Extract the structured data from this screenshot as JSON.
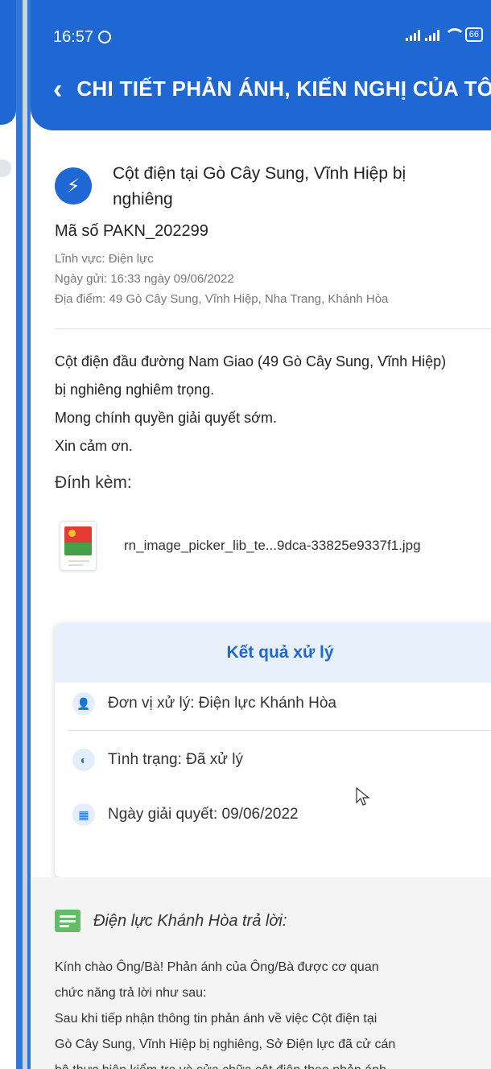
{
  "status_bar": {
    "time": "16:57",
    "battery": "66"
  },
  "header": {
    "title": "CHI TIẾT PHẢN ÁNH, KIẾN NGHỊ CỦA TÔI"
  },
  "issue": {
    "title": "Cột điện tại Gò Cây Sung, Vĩnh Hiệp bị nghiêng",
    "code": "Mã số PAKN_202299",
    "field": "Lĩnh vực: Điện lực",
    "sent_date": "Ngày gửi: 16:33 ngày 09/06/2022",
    "location": "Địa điểm: 49 Gò Cây Sung, Vĩnh Hiệp, Nha Trang, Khánh Hòa",
    "description": [
      "Cột điện đầu đường Nam Giao (49 Gò Cây Sung, Vĩnh Hiệp)",
      "bị nghiêng nghiêm trọng.",
      "Mong chính quyền giải quyết sớm.",
      "Xin cảm ơn."
    ],
    "attachment_label": "Đính kèm:",
    "attachment_file": "rn_image_picker_lib_te...9dca-33825e9337f1.jpg"
  },
  "result": {
    "title": "Kết quả xử lý",
    "unit": "Đơn vị xử lý: Điện lực Khánh Hòa",
    "status": "Tình trạng: Đã xử lý",
    "resolved_date": "Ngày giải quyết: 09/06/2022"
  },
  "reply": {
    "title": "Điện lực Khánh Hòa trả lời:",
    "lines": [
      "Kính chào Ông/Bà! Phản ánh của Ông/Bà được cơ quan",
      "chức năng trả lời như sau:",
      "Sau khi tiếp nhận thông tin phản ánh về việc Cột điện tại",
      "Gò Cây Sung, Vĩnh Hiệp bị nghiêng, Sở Điện lực đã cử cán",
      "bộ thực hiện kiểm tra và sửa chữa cột điện theo phản ánh"
    ]
  },
  "colors": {
    "primary": "#1f67d2",
    "result_header_bg": "#e8f1fb",
    "reply_bg": "#f4f4f4",
    "reply_icon": "#66bb6a"
  }
}
